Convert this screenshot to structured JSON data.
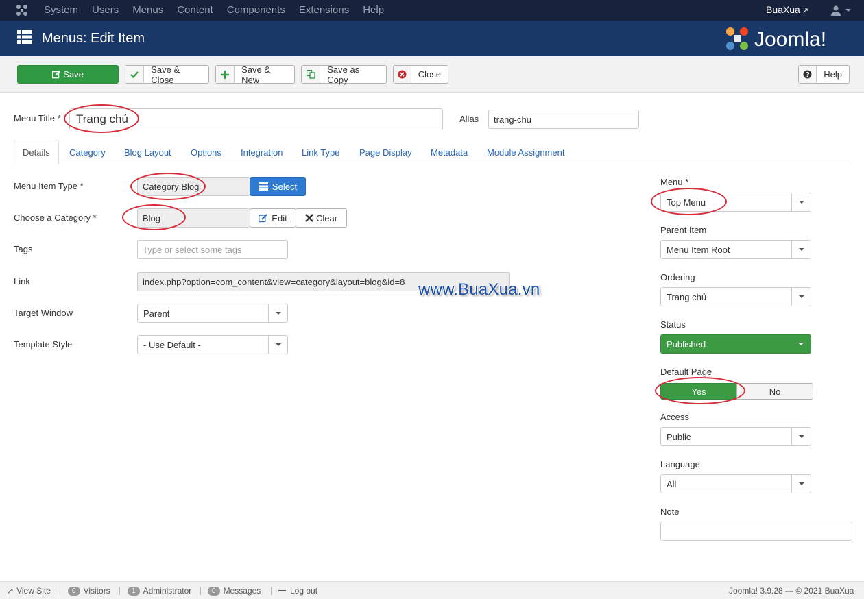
{
  "topnav": {
    "items": [
      "System",
      "Users",
      "Menus",
      "Content",
      "Components",
      "Extensions",
      "Help"
    ],
    "user": "BuaXua"
  },
  "header": {
    "title": "Menus: Edit Item",
    "brand": "Joomla!"
  },
  "toolbar": {
    "save": "Save",
    "save_close": "Save & Close",
    "save_new": "Save & New",
    "save_copy": "Save as Copy",
    "close": "Close",
    "help": "Help"
  },
  "form": {
    "menu_title_label": "Menu Title *",
    "menu_title_value": "Trang chủ",
    "alias_label": "Alias",
    "alias_value": "trang-chu"
  },
  "tabs": [
    "Details",
    "Category",
    "Blog Layout",
    "Options",
    "Integration",
    "Link Type",
    "Page Display",
    "Metadata",
    "Module Assignment"
  ],
  "details": {
    "item_type_label": "Menu Item Type *",
    "item_type_value": "Category Blog",
    "select_button": "Select",
    "category_label": "Choose a Category *",
    "category_value": "Blog",
    "edit_button": "Edit",
    "clear_button": "Clear",
    "tags_label": "Tags",
    "tags_placeholder": "Type or select some tags",
    "link_label": "Link",
    "link_value": "index.php?option=com_content&view=category&layout=blog&id=8",
    "target_label": "Target Window",
    "target_value": "Parent",
    "template_label": "Template Style",
    "template_value": "- Use Default -"
  },
  "sidebar": {
    "menu_label": "Menu *",
    "menu_value": "Top Menu",
    "parent_label": "Parent Item",
    "parent_value": "Menu Item Root",
    "ordering_label": "Ordering",
    "ordering_value": "Trang chủ",
    "status_label": "Status",
    "status_value": "Published",
    "default_label": "Default Page",
    "default_yes": "Yes",
    "default_no": "No",
    "access_label": "Access",
    "access_value": "Public",
    "language_label": "Language",
    "language_value": "All",
    "note_label": "Note",
    "note_value": ""
  },
  "watermark": "www.BuaXua.vn",
  "footer": {
    "view_site": "View Site",
    "visitors_count": "0",
    "visitors": "Visitors",
    "admin_count": "1",
    "admin": "Administrator",
    "messages_count": "0",
    "messages": "Messages",
    "logout": "Log out",
    "version": "Joomla! 3.9.28 — © 2021 BuaXua"
  },
  "colors": {
    "nav": "#17233d",
    "header": "#1a3867",
    "success": "#2f9a41",
    "primary": "#2f7bd0",
    "annotation": "#d72c3a"
  }
}
